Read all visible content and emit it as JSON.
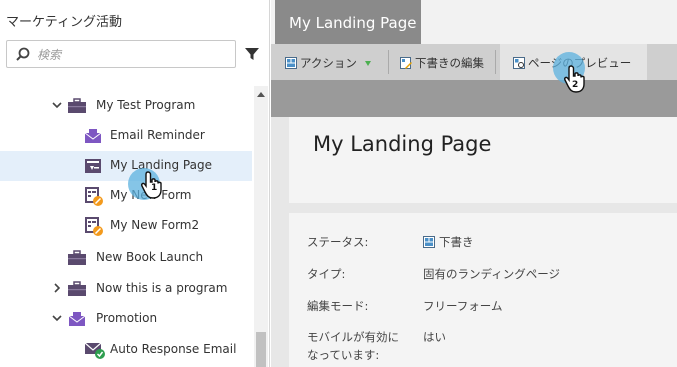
{
  "sidebar": {
    "title": "マーケティング活動",
    "search_placeholder": "検索",
    "items": [
      {
        "label": "My Test Program",
        "icon": "program-briefcase-icon",
        "expanded": true
      },
      {
        "label": "Email Reminder",
        "icon": "email-icon"
      },
      {
        "label": "My Landing Page",
        "icon": "landing-page-icon",
        "selected": true
      },
      {
        "label": "My New Form",
        "icon": "form-draft-icon"
      },
      {
        "label": "My New Form2",
        "icon": "form-draft-icon"
      },
      {
        "label": "New Book Launch",
        "icon": "program-briefcase-icon"
      },
      {
        "label": "Now this is a program",
        "icon": "program-briefcase-icon",
        "expanded": false
      },
      {
        "label": "Promotion",
        "icon": "email-program-icon",
        "expanded": true
      },
      {
        "label": "Auto Response Email",
        "icon": "email-approved-icon"
      }
    ]
  },
  "main": {
    "tab_label": "My Landing Page",
    "toolbar": {
      "actions": "アクション",
      "edit_draft": "下書きの編集",
      "preview_page": "ページのプレビュー"
    },
    "page_title": "My Landing Page",
    "properties": [
      {
        "label": "ステータス:",
        "value": "下書き"
      },
      {
        "label": "タイプ:",
        "value": "固有のランディングページ"
      },
      {
        "label": "編集モード:",
        "value": "フリーフォーム"
      },
      {
        "label": "モバイルが有効に",
        "label2": "なっています:",
        "value": "はい"
      }
    ]
  },
  "steps": {
    "step1": "1",
    "step2": "2"
  },
  "colors": {
    "accent": "#5cb2df",
    "program": "#5a4a6e",
    "purple": "#7e57c2",
    "selected_row": "#e4effa"
  }
}
